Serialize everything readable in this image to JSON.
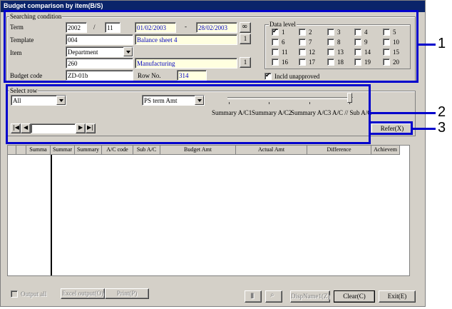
{
  "window": {
    "title": "Budget comparison by item(B/S)"
  },
  "search": {
    "legend": "Searching condition",
    "term_label": "Term",
    "term_year": "2002",
    "term_sep": "/",
    "term_month": "11",
    "date_from": "01/02/2003",
    "date_dash": "-",
    "date_to": "28/02/2003",
    "template_label": "Template",
    "template_code": "004",
    "template_name": "Balance sheet 4",
    "template_btn": "1",
    "item_label": "Item",
    "item_value": "Department",
    "item_code": "260",
    "item_name": "Manufacturing",
    "item_btn": "1",
    "budget_code_label": "Budget code",
    "budget_code": "ZD-01b",
    "row_no_label": "Row No.",
    "row_no": "314"
  },
  "data_level": {
    "legend": "Data level",
    "levels": [
      "1",
      "2",
      "3",
      "4",
      "5",
      "6",
      "7",
      "8",
      "9",
      "10",
      "11",
      "12",
      "13",
      "14",
      "15",
      "16",
      "17",
      "18",
      "19",
      "20"
    ],
    "checked": [
      "1"
    ],
    "incld_unapproved": "Incld unapproved"
  },
  "select_row": {
    "legend": "Select row",
    "row_value": "All",
    "amt_value": "PS term Amt",
    "slider_labels": [
      "Summary A/C1",
      "Summary A/C2",
      "Summary A/C3",
      "A/C // Sub A/C"
    ],
    "refer_btn": "Refer(X)"
  },
  "grid": {
    "headers": [
      "",
      "",
      "Summa",
      "Summar",
      "Summary",
      "A/C code",
      "Sub A/C",
      "Budget Amt",
      "Actual Amt",
      "Difference",
      "Achievem"
    ]
  },
  "footer": {
    "output_all": "Output all",
    "excel_output": "Excel output(O)",
    "print": "Print(P)",
    "dispname": "DispName1(Z)",
    "clear": "Clear(C)",
    "exit": "Exit(E)"
  },
  "callouts": [
    "1",
    "2",
    "3"
  ],
  "colors": {
    "highlight": "#0000cc",
    "titlebar": "#0a246a",
    "face": "#d4d0c8"
  }
}
